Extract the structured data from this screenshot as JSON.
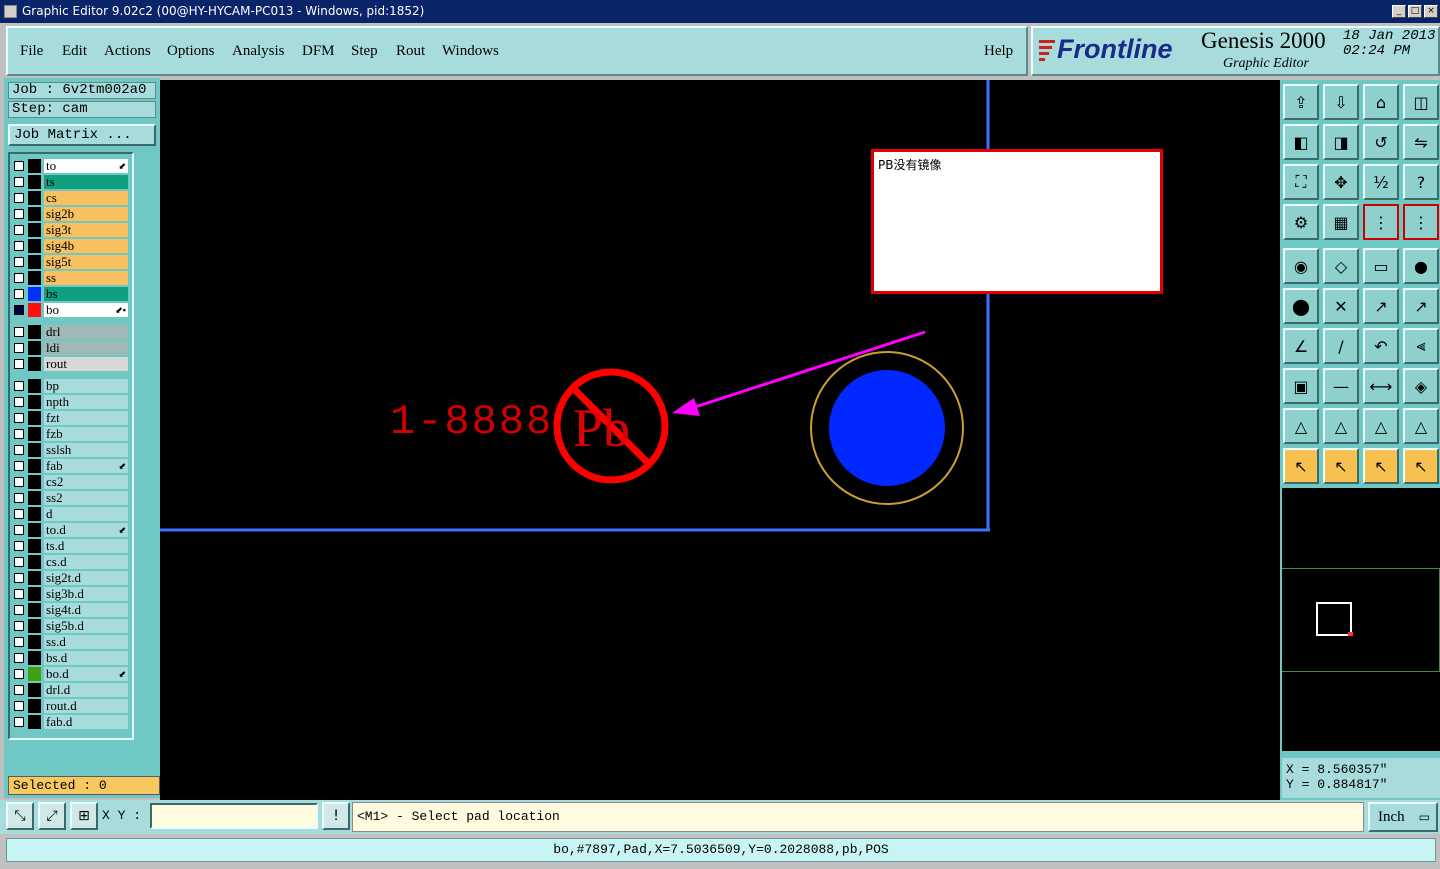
{
  "window": {
    "title": "Graphic Editor 9.02c2 (00@HY-HYCAM-PC013 - Windows, pid:1852)",
    "buttons": [
      "_",
      "□",
      "×"
    ]
  },
  "menu": {
    "items": [
      "File",
      "Edit",
      "Actions",
      "Options",
      "Analysis",
      "DFM",
      "Step",
      "Rout",
      "Windows"
    ],
    "help": "Help"
  },
  "brand": {
    "logo": "Frontline",
    "product": "Genesis 2000",
    "subtitle": "Graphic Editor",
    "date": "18 Jan 2013",
    "time": "02:24 PM"
  },
  "job": {
    "job_label": "Job  :  6v2tm002a0",
    "step_label": "Step: cam",
    "matrix_button": "Job Matrix ..."
  },
  "layers": [
    {
      "name": "to",
      "color": "#ffffff",
      "swatch": "",
      "flag": "⬋"
    },
    {
      "name": "ts",
      "color": "#10a080",
      "swatch": "",
      "flag": ""
    },
    {
      "name": "cs",
      "color": "#f8c060",
      "swatch": "",
      "flag": ""
    },
    {
      "name": "sig2b",
      "color": "#f8c060",
      "swatch": "",
      "flag": ""
    },
    {
      "name": "sig3t",
      "color": "#f8c060",
      "swatch": "",
      "flag": ""
    },
    {
      "name": "sig4b",
      "color": "#f8c060",
      "swatch": "",
      "flag": ""
    },
    {
      "name": "sig5t",
      "color": "#f8c060",
      "swatch": "",
      "flag": ""
    },
    {
      "name": "ss",
      "color": "#f8c060",
      "swatch": "",
      "flag": ""
    },
    {
      "name": "bs",
      "color": "#10a080",
      "swatch": "#0030ff",
      "flag": ""
    },
    {
      "name": "bo",
      "color": "#ffffff",
      "swatch": "#ff1010",
      "flag": "⬋▪"
    },
    {
      "name": "drl",
      "color": "#a0b8b8",
      "swatch": "",
      "flag": ""
    },
    {
      "name": "ldi",
      "color": "#a0b8b8",
      "swatch": "",
      "flag": ""
    },
    {
      "name": "rout",
      "color": "#d8d8d8",
      "swatch": "",
      "flag": ""
    },
    {
      "name": "bp",
      "color": "#a8dcdc",
      "swatch": "",
      "flag": ""
    },
    {
      "name": "npth",
      "color": "#a8dcdc",
      "swatch": "",
      "flag": ""
    },
    {
      "name": "fzt",
      "color": "#a8dcdc",
      "swatch": "",
      "flag": ""
    },
    {
      "name": "fzb",
      "color": "#a8dcdc",
      "swatch": "",
      "flag": ""
    },
    {
      "name": "sslsh",
      "color": "#a8dcdc",
      "swatch": "",
      "flag": ""
    },
    {
      "name": "fab",
      "color": "#a8dcdc",
      "swatch": "",
      "flag": "⬋"
    },
    {
      "name": "cs2",
      "color": "#a8dcdc",
      "swatch": "",
      "flag": ""
    },
    {
      "name": "ss2",
      "color": "#a8dcdc",
      "swatch": "",
      "flag": ""
    },
    {
      "name": "d",
      "color": "#a8dcdc",
      "swatch": "",
      "flag": ""
    },
    {
      "name": "to.d",
      "color": "#a8dcdc",
      "swatch": "",
      "flag": "⬋"
    },
    {
      "name": "ts.d",
      "color": "#a8dcdc",
      "swatch": "",
      "flag": ""
    },
    {
      "name": "cs.d",
      "color": "#a8dcdc",
      "swatch": "",
      "flag": ""
    },
    {
      "name": "sig2t.d",
      "color": "#a8dcdc",
      "swatch": "",
      "flag": ""
    },
    {
      "name": "sig3b.d",
      "color": "#a8dcdc",
      "swatch": "",
      "flag": ""
    },
    {
      "name": "sig4t.d",
      "color": "#a8dcdc",
      "swatch": "",
      "flag": ""
    },
    {
      "name": "sig5b.d",
      "color": "#a8dcdc",
      "swatch": "",
      "flag": ""
    },
    {
      "name": "ss.d",
      "color": "#a8dcdc",
      "swatch": "",
      "flag": ""
    },
    {
      "name": "bs.d",
      "color": "#a8dcdc",
      "swatch": "",
      "flag": ""
    },
    {
      "name": "bo.d",
      "color": "#a8dcdc",
      "swatch": "#40a010",
      "flag": "⬋"
    },
    {
      "name": "drl.d",
      "color": "#a8dcdc",
      "swatch": "",
      "flag": ""
    },
    {
      "name": "rout.d",
      "color": "#a8dcdc",
      "swatch": "",
      "flag": ""
    },
    {
      "name": "fab.d",
      "color": "#a8dcdc",
      "swatch": "",
      "flag": ""
    }
  ],
  "selected": "Selected : 0",
  "canvas": {
    "note_text": "PB没有镜像",
    "part_text": "1-8888",
    "symbol_text": "Pb"
  },
  "coords": {
    "x": "X = 8.560357\"",
    "y": "Y = 0.884817\""
  },
  "bottom": {
    "xy_label": "X Y :",
    "xy_value": "",
    "bang": "!",
    "prompt": "<M1> - Select pad location",
    "unit": "Inch"
  },
  "status": "bo,#7897,Pad,X=7.5036509,Y=0.2028088,pb,POS",
  "tools": [
    "open-job-icon",
    "save-icon",
    "home-icon",
    "window-icon",
    "pan-left-icon",
    "pan-right-icon",
    "rotate-icon",
    "flip-icon",
    "zoom-fit-icon",
    "zoom-center-icon",
    "scale-1-2-icon",
    "help-icon",
    "tool-config-icon",
    "grid-icon",
    "layer-toggle-a-icon",
    "layer-toggle-b-icon",
    "select-pad-icon",
    "select-area-icon",
    "measure-icon",
    "pad-dot-icon",
    "snap-icon",
    "cross-icon",
    "link-a-icon",
    "link-b-icon",
    "line-a-icon",
    "line-b-icon",
    "undo-icon",
    "frame-icon",
    "pad-select-icon",
    "minus-icon",
    "dimension-icon",
    "cluster-icon",
    "triangle-a-icon",
    "triangle-b-icon",
    "triangle-c-icon",
    "triangle-d-icon",
    "pointer-a-icon",
    "pointer-b-icon",
    "pointer-c-icon",
    "pointer-d-icon"
  ]
}
